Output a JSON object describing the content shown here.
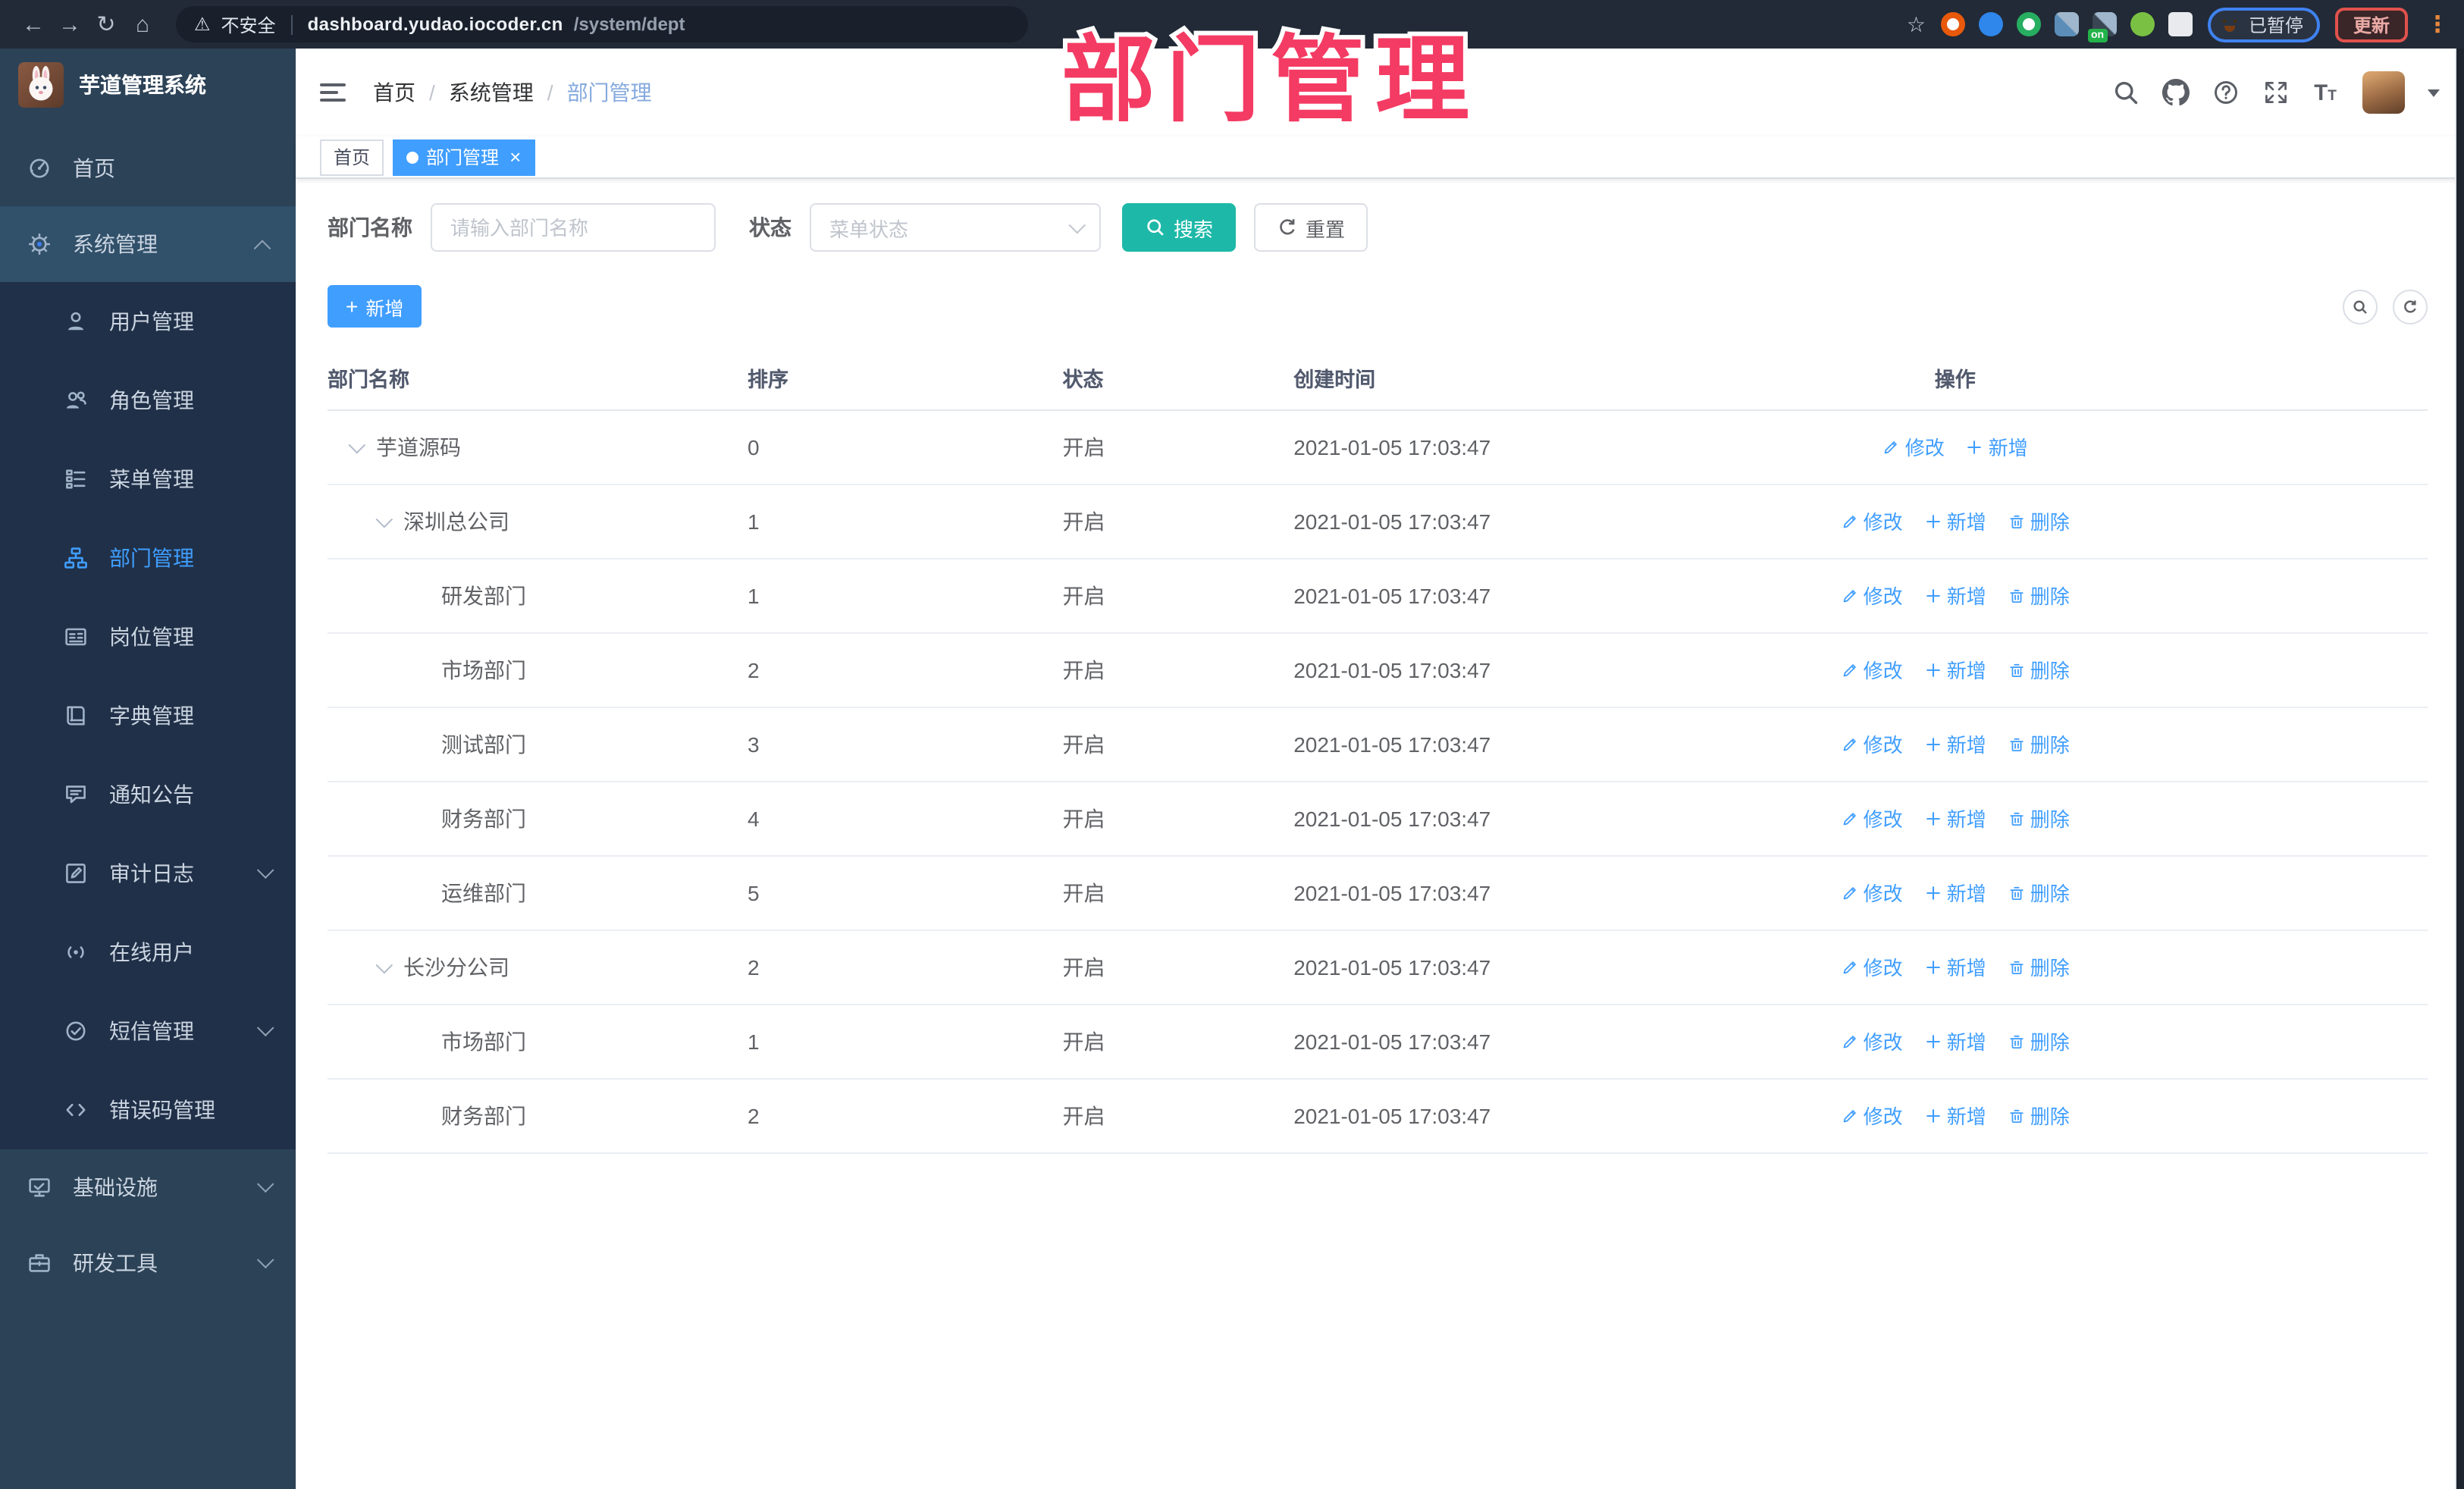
{
  "colors": {
    "accent": "#409eff",
    "teal": "#1db8a8",
    "annotation_pink": "#f43b63",
    "sidebar_bg": "#2c4257",
    "submenu_bg": "#203048",
    "chrome_bg": "#212a36"
  },
  "annotation": {
    "text": "部门管理"
  },
  "browser": {
    "nav_icons": [
      "back-icon",
      "forward-icon",
      "reload-icon",
      "home-icon"
    ],
    "nav_glyphs": {
      "back": "←",
      "forward": "→",
      "reload": "↻",
      "home": "⌂"
    },
    "security_label": "不安全",
    "url_host": "dashboard.yudao.iocoder.cn",
    "url_path": "/system/dept",
    "extensions": [
      {
        "icon": "target-extension-icon",
        "color": "#e8590c",
        "shape": "ring"
      },
      {
        "icon": "pin-extension-icon",
        "color": "#2f86eb",
        "shape": "dot"
      },
      {
        "icon": "v-extension-icon",
        "color": "#27ae60",
        "shape": "ring"
      },
      {
        "icon": "grid-extension-icon",
        "color": "#5b8db8",
        "shape": "grid"
      },
      {
        "icon": "tabs-extension-icon",
        "color": "#3a4553",
        "shape": "grid",
        "badge": "on"
      },
      {
        "icon": "leaf-extension-icon",
        "color": "#7ac143",
        "shape": "dot"
      },
      {
        "icon": "puzzle-extension-icon",
        "color": "#e8eaed",
        "shape": "dot"
      }
    ],
    "paused_badge": "已暂停",
    "update_button": "更新"
  },
  "sidebar": {
    "title": "芋道管理系统",
    "items": [
      {
        "label": "首页",
        "icon": "dashboard-icon"
      },
      {
        "label": "系统管理",
        "icon": "gear-icon",
        "open": true,
        "arrow": "up",
        "children": [
          {
            "label": "用户管理",
            "icon": "user-icon"
          },
          {
            "label": "角色管理",
            "icon": "users-icon"
          },
          {
            "label": "菜单管理",
            "icon": "menu-tree-icon"
          },
          {
            "label": "部门管理",
            "icon": "org-icon",
            "active": true
          },
          {
            "label": "岗位管理",
            "icon": "idcard-icon"
          },
          {
            "label": "字典管理",
            "icon": "book-icon"
          },
          {
            "label": "通知公告",
            "icon": "notice-icon"
          },
          {
            "label": "审计日志",
            "icon": "audit-icon",
            "arrow": "down"
          },
          {
            "label": "在线用户",
            "icon": "online-icon"
          },
          {
            "label": "短信管理",
            "icon": "sms-icon",
            "arrow": "down"
          },
          {
            "label": "错误码管理",
            "icon": "code-icon"
          }
        ]
      },
      {
        "label": "基础设施",
        "icon": "infra-icon",
        "arrow": "down"
      },
      {
        "label": "研发工具",
        "icon": "tools-icon",
        "arrow": "down"
      }
    ]
  },
  "header": {
    "breadcrumb": [
      "首页",
      "系统管理",
      "部门管理"
    ],
    "right_icons": [
      "search-icon",
      "github-icon",
      "help-icon",
      "fullscreen-icon",
      "font-size-icon"
    ]
  },
  "tabs": [
    {
      "label": "首页",
      "active": false,
      "closable": false
    },
    {
      "label": "部门管理",
      "active": true,
      "closable": true
    }
  ],
  "search": {
    "name_label": "部门名称",
    "name_placeholder": "请输入部门名称",
    "status_label": "状态",
    "status_placeholder": "菜单状态",
    "search_button": "搜索",
    "reset_button": "重置"
  },
  "toolbar": {
    "add_button": "新增"
  },
  "table": {
    "columns": [
      "部门名称",
      "排序",
      "状态",
      "创建时间",
      "操作"
    ],
    "action_labels": {
      "edit": "修改",
      "add": "新增",
      "delete": "删除"
    },
    "rows": [
      {
        "name": "芋道源码",
        "level": 0,
        "expandable": true,
        "sort": "0",
        "status": "开启",
        "time": "2021-01-05 17:03:47",
        "actions": [
          "edit",
          "add"
        ]
      },
      {
        "name": "深圳总公司",
        "level": 1,
        "expandable": true,
        "sort": "1",
        "status": "开启",
        "time": "2021-01-05 17:03:47",
        "actions": [
          "edit",
          "add",
          "delete"
        ]
      },
      {
        "name": "研发部门",
        "level": 2,
        "expandable": false,
        "sort": "1",
        "status": "开启",
        "time": "2021-01-05 17:03:47",
        "actions": [
          "edit",
          "add",
          "delete"
        ]
      },
      {
        "name": "市场部门",
        "level": 2,
        "expandable": false,
        "sort": "2",
        "status": "开启",
        "time": "2021-01-05 17:03:47",
        "actions": [
          "edit",
          "add",
          "delete"
        ]
      },
      {
        "name": "测试部门",
        "level": 2,
        "expandable": false,
        "sort": "3",
        "status": "开启",
        "time": "2021-01-05 17:03:47",
        "actions": [
          "edit",
          "add",
          "delete"
        ]
      },
      {
        "name": "财务部门",
        "level": 2,
        "expandable": false,
        "sort": "4",
        "status": "开启",
        "time": "2021-01-05 17:03:47",
        "actions": [
          "edit",
          "add",
          "delete"
        ]
      },
      {
        "name": "运维部门",
        "level": 2,
        "expandable": false,
        "sort": "5",
        "status": "开启",
        "time": "2021-01-05 17:03:47",
        "actions": [
          "edit",
          "add",
          "delete"
        ]
      },
      {
        "name": "长沙分公司",
        "level": 1,
        "expandable": true,
        "sort": "2",
        "status": "开启",
        "time": "2021-01-05 17:03:47",
        "actions": [
          "edit",
          "add",
          "delete"
        ]
      },
      {
        "name": "市场部门",
        "level": 2,
        "expandable": false,
        "sort": "1",
        "status": "开启",
        "time": "2021-01-05 17:03:47",
        "actions": [
          "edit",
          "add",
          "delete"
        ]
      },
      {
        "name": "财务部门",
        "level": 2,
        "expandable": false,
        "sort": "2",
        "status": "开启",
        "time": "2021-01-05 17:03:47",
        "actions": [
          "edit",
          "add",
          "delete"
        ]
      }
    ]
  }
}
